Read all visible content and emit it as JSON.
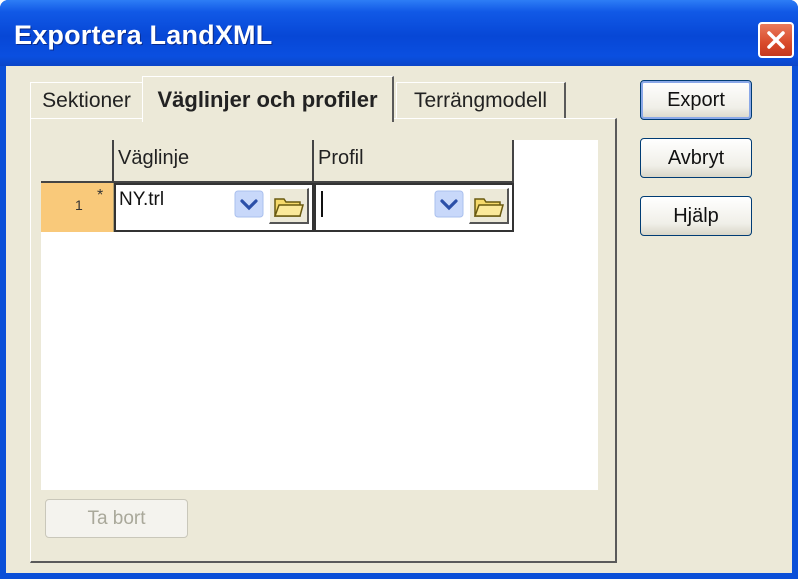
{
  "window": {
    "title": "Exportera LandXML"
  },
  "tabs": [
    {
      "label": "Sektioner"
    },
    {
      "label": "Väglinjer och profiler"
    },
    {
      "label": "Terrängmodell"
    }
  ],
  "grid": {
    "columns": [
      "Väglinje",
      "Profil"
    ],
    "rows": [
      {
        "number": "1",
        "marker": "*",
        "vaglinje": "NY.trl",
        "profil": ""
      }
    ]
  },
  "buttons": {
    "remove": "Ta bort",
    "export": "Export",
    "cancel": "Avbryt",
    "help": "Hjälp"
  }
}
